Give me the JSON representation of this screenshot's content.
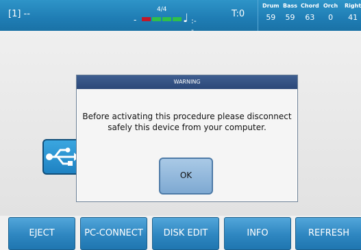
{
  "status_bar": {
    "song": "[1] --",
    "dash": "-",
    "time_signature": "4/4",
    "note_value": ":--",
    "tempo": "T:0",
    "beat_colors": [
      "#c0182a",
      "#2fbf4a",
      "#2fbf4a",
      "#2fbf4a"
    ],
    "volumes": [
      {
        "label": "Drum",
        "value": "59"
      },
      {
        "label": "Bass",
        "value": "59"
      },
      {
        "label": "Chord",
        "value": "63"
      },
      {
        "label": "Orch",
        "value": "0"
      },
      {
        "label": "Right",
        "value": "41"
      }
    ]
  },
  "background_icon": "usb-icon",
  "dialog": {
    "title": "WARNING",
    "message_line1": "Before activating this procedure please disconnect",
    "message_line2": "safely this device from your computer.",
    "ok_label": "OK"
  },
  "function_buttons": [
    {
      "label": "EJECT"
    },
    {
      "label": "PC-CONNECT"
    },
    {
      "label": "DISK EDIT"
    },
    {
      "label": "INFO"
    },
    {
      "label": "REFRESH"
    }
  ]
}
